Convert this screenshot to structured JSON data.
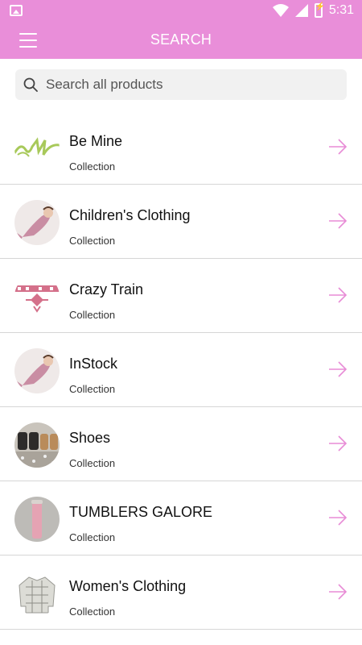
{
  "status_bar": {
    "time": "5:31"
  },
  "app_bar": {
    "title": "SEARCH"
  },
  "search": {
    "placeholder": "Search all products",
    "value": ""
  },
  "colors": {
    "accent": "#e98ed9",
    "arrow": "#e88cd6"
  },
  "items": [
    {
      "name": "Be Mine",
      "type": "Collection",
      "thumb_icon": "be-mine-logo"
    },
    {
      "name": "Children's Clothing",
      "type": "Collection",
      "thumb_icon": "mermaid-blanket-photo"
    },
    {
      "name": "Crazy Train",
      "type": "Collection",
      "thumb_icon": "crazy-train-logo"
    },
    {
      "name": "InStock",
      "type": "Collection",
      "thumb_icon": "mermaid-blanket-photo"
    },
    {
      "name": "Shoes",
      "type": "Collection",
      "thumb_icon": "shoes-photo"
    },
    {
      "name": "TUMBLERS GALORE",
      "type": "Collection",
      "thumb_icon": "pink-tumbler-photo"
    },
    {
      "name": "Women's Clothing",
      "type": "Collection",
      "thumb_icon": "plaid-shirt-photo"
    }
  ]
}
